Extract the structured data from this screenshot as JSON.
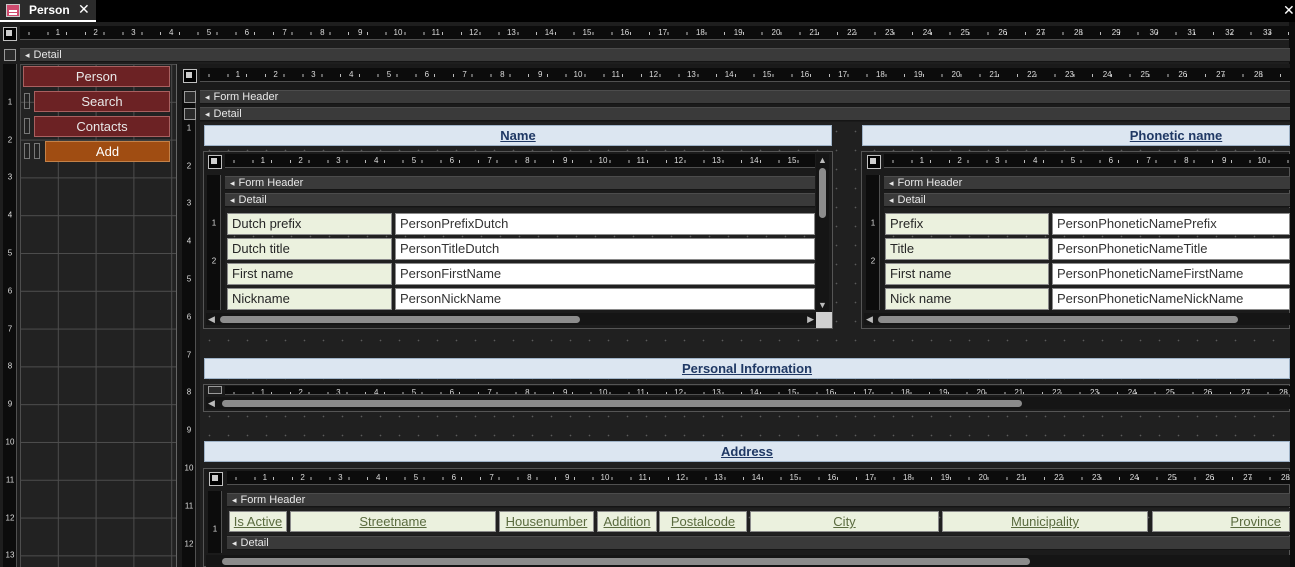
{
  "tab": {
    "title": "Person",
    "close": "✕"
  },
  "window": {
    "close": "✕"
  },
  "sections": {
    "detail": "Detail",
    "form_header": "Form Header"
  },
  "nav": {
    "person": "Person",
    "search": "Search",
    "contacts": "Contacts",
    "add": "Add"
  },
  "titles": {
    "name": "Name",
    "phonetic": "Phonetic name",
    "personal": "Personal Information",
    "address": "Address"
  },
  "name_rows": [
    {
      "label": "Dutch prefix",
      "field": "PersonPrefixDutch"
    },
    {
      "label": "Dutch title",
      "field": "PersonTitleDutch"
    },
    {
      "label": "First name",
      "field": "PersonFirstName"
    },
    {
      "label": "Nickname",
      "field": "PersonNickName"
    }
  ],
  "phonetic_rows": [
    {
      "label": "Prefix",
      "field": "PersonPhoneticNamePrefix"
    },
    {
      "label": "Title",
      "field": "PersonPhoneticNameTitle"
    },
    {
      "label": "First name",
      "field": "PersonPhoneticNameFirstName"
    },
    {
      "label": "Nick name",
      "field": "PersonPhoneticNameNickName"
    }
  ],
  "address_headers": [
    "Is Active",
    "Streetname",
    "Housenumber",
    "Addition",
    "Postalcode",
    "City",
    "Municipality",
    "Province"
  ],
  "icons": {
    "tab": "form-icon",
    "section": "section-collapse-icon"
  },
  "colors": {
    "title_bg": "#dce6f1",
    "label_bg": "#ebf1de",
    "nav_btn": "#6c2224",
    "add_btn": "#a04d12"
  }
}
